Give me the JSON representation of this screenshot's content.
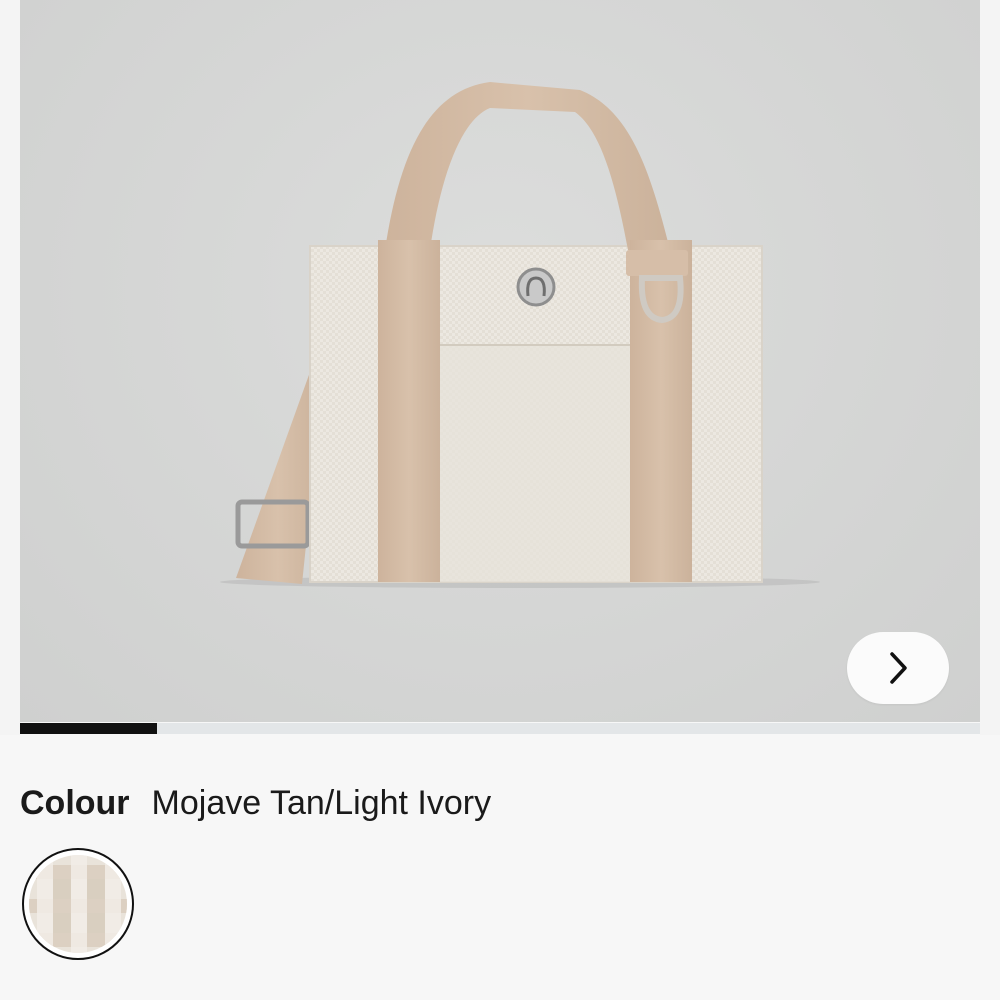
{
  "gallery": {
    "image_subject": "tote-bag-product-photo",
    "next_icon": "chevron-right-icon",
    "progress_fraction": 0.143
  },
  "colour": {
    "label": "Colour",
    "value": "Mojave Tan/Light Ivory",
    "swatches": [
      {
        "name": "Mojave Tan/Light Ivory",
        "selected": true
      }
    ]
  },
  "colors": {
    "tan": "#d5bea8",
    "ivory": "#ece8e0",
    "background": "#d6d7d6",
    "accent": "#111111"
  }
}
